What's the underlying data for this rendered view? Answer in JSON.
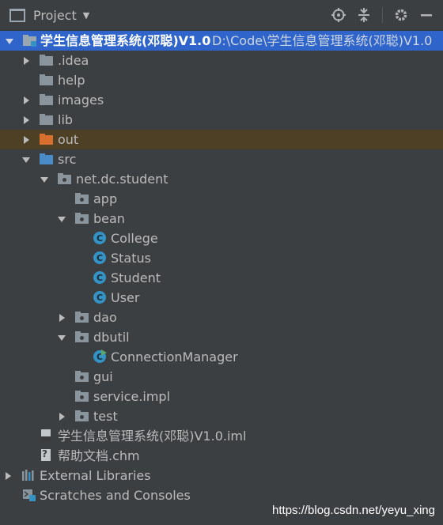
{
  "toolbar": {
    "title": "Project",
    "icons": [
      "locate-icon",
      "collapse-all-icon",
      "gear-icon",
      "hide-icon"
    ]
  },
  "tree": {
    "root": {
      "label": "学生信息管理系统(邓聪)V1.0",
      "path": "D:\\Code\\学生信息管理系统(邓聪)V1.0"
    },
    "items": {
      "idea": ".idea",
      "help": "help",
      "images": "images",
      "lib": "lib",
      "out": "out",
      "src": "src",
      "pkg": "net.dc.student",
      "app": "app",
      "bean": "bean",
      "college": "College",
      "status": "Status",
      "student": "Student",
      "user": "User",
      "dao": "dao",
      "dbutil": "dbutil",
      "connmgr": "ConnectionManager",
      "gui": "gui",
      "service": "service.impl",
      "test": "test",
      "iml": "学生信息管理系统(邓聪)V1.0.iml",
      "chm": "帮助文档.chm",
      "extlib": "External Libraries",
      "scratches": "Scratches and Consoles"
    },
    "class_icon_letter": "C"
  },
  "watermark": "https://blog.csdn.net/yeyu_xing",
  "colors": {
    "background": "#3c3f41",
    "selection": "#2f65ca",
    "out_highlight": "#4d4025",
    "folder_gray": "#8a949c",
    "folder_blue": "#4a8cc7",
    "folder_orange": "#d7702e",
    "class_blue": "#3592c4"
  }
}
